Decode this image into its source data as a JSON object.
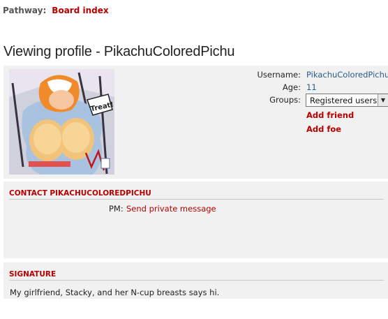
{
  "breadcrumb": {
    "label": "Pathway:",
    "items": [
      {
        "label": "Board index"
      }
    ]
  },
  "page": {
    "title": "Viewing profile - PikachuColoredPichu"
  },
  "profile": {
    "avatar_caption": "Treat!",
    "username_label": "Username:",
    "username": "PikachuColoredPichu",
    "age_label": "Age:",
    "age": "11",
    "groups_label": "Groups:",
    "groups_selected": "Registered users",
    "add_friend": "Add friend",
    "add_foe": "Add foe"
  },
  "contact": {
    "heading": "CONTACT PIKACHUCOLOREDPICHU",
    "pm_label": "PM:",
    "pm_link": "Send private message"
  },
  "signature": {
    "heading": "SIGNATURE",
    "text": "My girlfriend, Stacky, and her N-cup breasts says hi."
  },
  "colors": {
    "link_red": "#b80000",
    "link_blue": "#2a5b8a",
    "panel_bg": "#f1f1f1"
  }
}
